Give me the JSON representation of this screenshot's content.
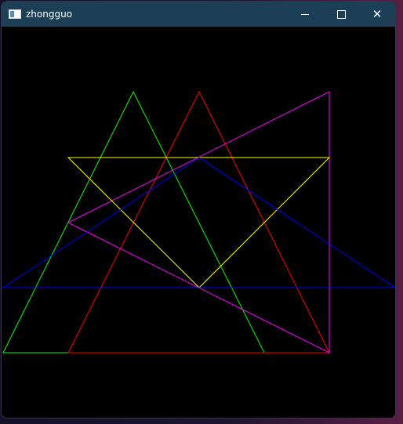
{
  "window": {
    "title": "zhongguo",
    "icon": "app-window-icon",
    "buttons": {
      "minimize_icon": "minimize-icon",
      "maximize_icon": "maximize-icon",
      "close_icon": "close-icon",
      "close_glyph": "✕"
    }
  },
  "colors": {
    "titlebar": "#1c3f56",
    "canvas": "#000000",
    "green": "#00ff00",
    "red": "#ff0000",
    "magenta": "#ff00ff",
    "yellow": "#ffff00",
    "blue": "#0000ff"
  },
  "drawing": {
    "shapes": [
      {
        "name": "green-triangle",
        "color": "green"
      },
      {
        "name": "red-triangle",
        "color": "red"
      },
      {
        "name": "magenta-triangle",
        "color": "magenta"
      },
      {
        "name": "yellow-triangle",
        "color": "yellow"
      },
      {
        "name": "blue-triangle",
        "color": "blue"
      }
    ]
  }
}
